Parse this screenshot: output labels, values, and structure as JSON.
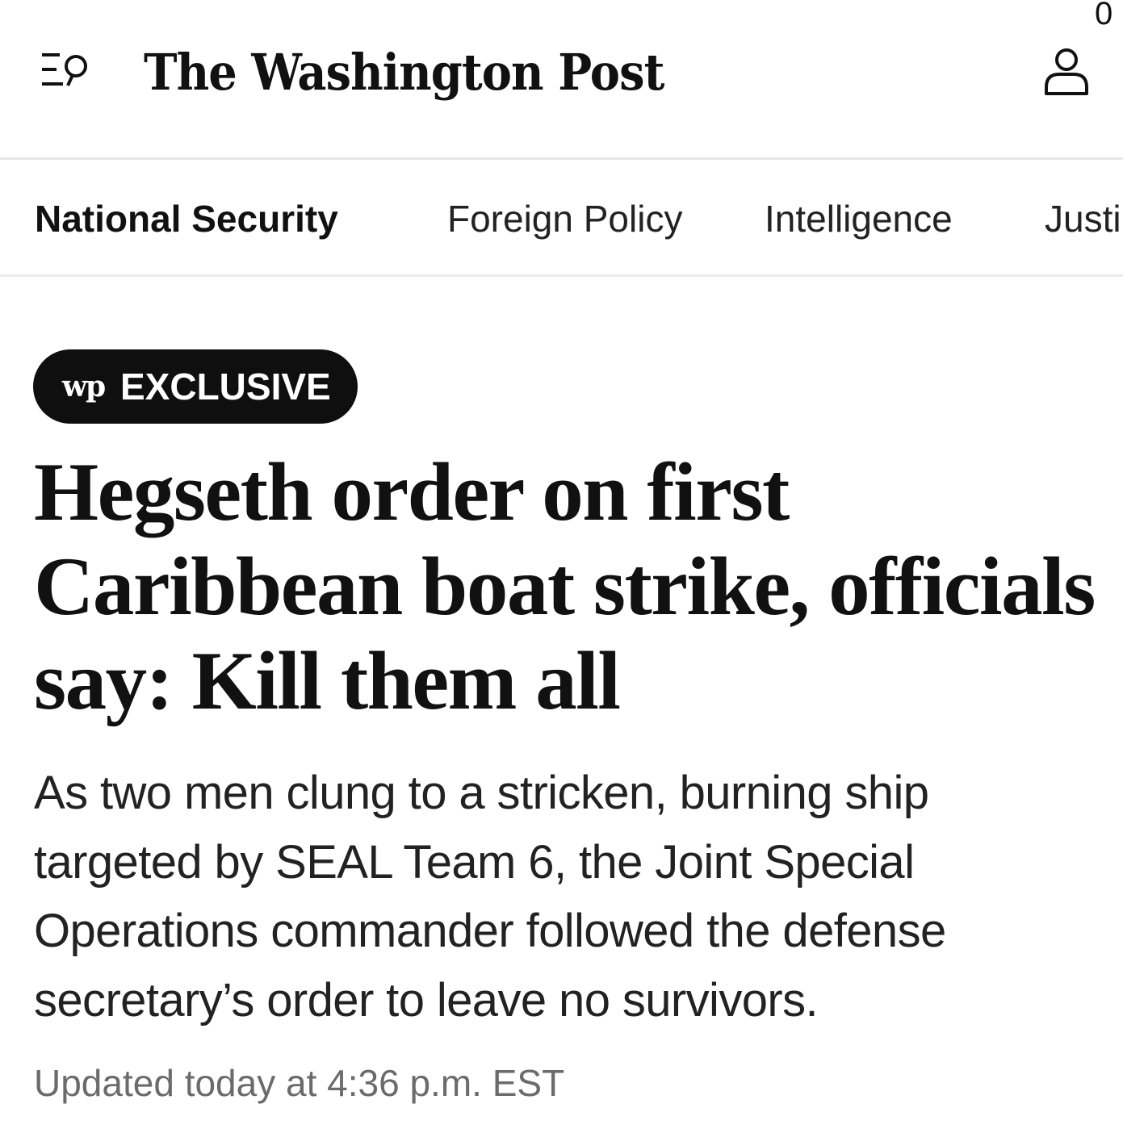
{
  "header": {
    "masthead": "The Washington Post",
    "corner_glyph": "0",
    "menu_icon": "menu-search-icon",
    "account_icon": "user-icon"
  },
  "section_nav": {
    "items": [
      {
        "label": "National Security",
        "active": true
      },
      {
        "label": "Foreign Policy",
        "active": false
      },
      {
        "label": "Intelligence",
        "active": false
      },
      {
        "label": "Justi",
        "active": false
      }
    ]
  },
  "article": {
    "badge": {
      "logo": "wp",
      "label": "EXCLUSIVE"
    },
    "headline": "Hegseth order on first Caribbean boat strike, officials say: Kill them all",
    "dek": "As two men clung to a stricken, burning ship targeted by SEAL Team 6, the Joint Special Operations commander followed the defense secretary’s order to leave no survivors.",
    "timestamp": "Updated today at 4:36 p.m. EST"
  },
  "colors": {
    "background": "#ffffff",
    "text": "#111111",
    "badge_background": "#0f0f0f",
    "badge_text": "#ffffff",
    "timestamp": "#6b6b6b",
    "divider": "#e6e6e6"
  }
}
